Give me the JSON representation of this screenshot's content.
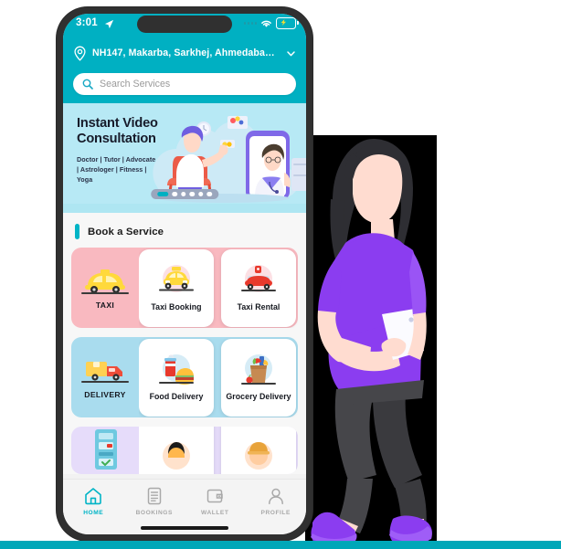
{
  "app": {
    "accent_teal": "#00b0c2",
    "strip_color": "#00a7b8"
  },
  "status_bar": {
    "time": "3:01",
    "location_arrow_icon": "location-arrow-icon",
    "signal_icon": "signal-dots-icon",
    "wifi_icon": "wifi-icon",
    "battery_icon": "battery-charging-icon"
  },
  "location_bar": {
    "pin_icon": "location-pin-icon",
    "address": "NH147, Makarba, Sarkhej, Ahmedabad…",
    "chevron_icon": "chevron-down-icon"
  },
  "search": {
    "icon": "search-icon",
    "placeholder": "Search Services",
    "value": ""
  },
  "banner": {
    "title_line1": "Instant Video",
    "title_line2": "Consultation",
    "subtitle_line1": "Doctor | Tutor | Advocate",
    "subtitle_line2": "| Astrologer | Fitness |",
    "subtitle_line3": "Yoga",
    "carousel": {
      "total": 6,
      "active_index": 0
    }
  },
  "section": {
    "title": "Book a Service"
  },
  "rows": [
    {
      "category": "TAXI",
      "category_icon": "taxi-car-icon",
      "theme": "taxi",
      "cards": [
        {
          "label": "Taxi Booking",
          "icon": "taxi-front-icon"
        },
        {
          "label": "Taxi Rental",
          "icon": "car-rental-key-icon"
        }
      ]
    },
    {
      "category": "DELIVERY",
      "category_icon": "delivery-truck-icon",
      "theme": "delivery",
      "cards": [
        {
          "label": "Food Delivery",
          "icon": "burger-drink-icon"
        },
        {
          "label": "Grocery Delivery",
          "icon": "grocery-bag-icon"
        }
      ]
    },
    {
      "category": "",
      "category_icon": "atm-machine-icon",
      "theme": "other",
      "cards": [
        {
          "label": "",
          "icon": "person-avatar-icon"
        },
        {
          "label": "",
          "icon": "worker-avatar-icon"
        }
      ]
    }
  ],
  "tabbar": {
    "items": [
      {
        "label": "HOME",
        "icon": "home-icon",
        "active": true
      },
      {
        "label": "BOOKINGS",
        "icon": "list-document-icon",
        "active": false
      },
      {
        "label": "WALLET",
        "icon": "wallet-icon",
        "active": false
      },
      {
        "label": "PROFILE",
        "icon": "person-icon",
        "active": false
      }
    ]
  }
}
